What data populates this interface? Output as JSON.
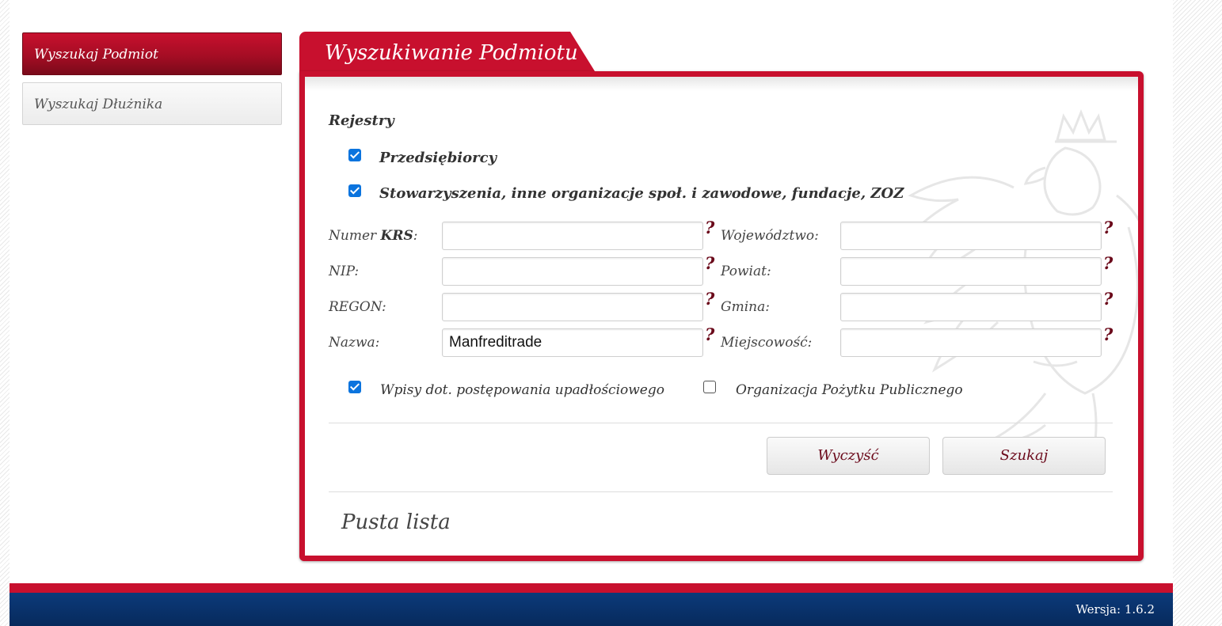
{
  "sidebar": {
    "items": [
      {
        "label": "Wyszukaj Podmiot",
        "active": true
      },
      {
        "label": "Wyszukaj Dłużnika",
        "active": false
      }
    ]
  },
  "panel": {
    "tab_title": "Wyszukiwanie Podmiotu",
    "registers_title": "Rejestry",
    "registers": [
      {
        "label": "Przedsiębiorcy",
        "checked": true
      },
      {
        "label": "Stowarzyszenia, inne organizacje społ. i zawodowe, fundacje, ZOZ",
        "checked": true
      }
    ],
    "fields_left": [
      {
        "label_prefix": "Numer ",
        "label_bold": "KRS",
        "label_suffix": ":",
        "value": ""
      },
      {
        "label": "NIP:",
        "value": ""
      },
      {
        "label": "REGON:",
        "value": ""
      },
      {
        "label": "Nazwa:",
        "value": "Manfreditrade"
      }
    ],
    "fields_right": [
      {
        "label": "Województwo:",
        "value": ""
      },
      {
        "label": "Powiat:",
        "value": ""
      },
      {
        "label": "Gmina:",
        "value": ""
      },
      {
        "label": "Miejscowość:",
        "value": ""
      }
    ],
    "help_mark": "?",
    "options": [
      {
        "label": "Wpisy dot. postępowania upadłościowego",
        "checked": true
      },
      {
        "label": "Organizacja Pożytku Publicznego",
        "checked": false
      }
    ],
    "buttons": {
      "clear": "Wyczyść",
      "search": "Szukaj"
    },
    "results_empty": "Pusta lista"
  },
  "footer": {
    "version": "Wersja: 1.6.2"
  },
  "colors": {
    "accent_red": "#c8102e",
    "dark_red": "#6b0a1b",
    "footer_blue": "#0c3a7a",
    "checkbox_blue": "#0b74de"
  }
}
